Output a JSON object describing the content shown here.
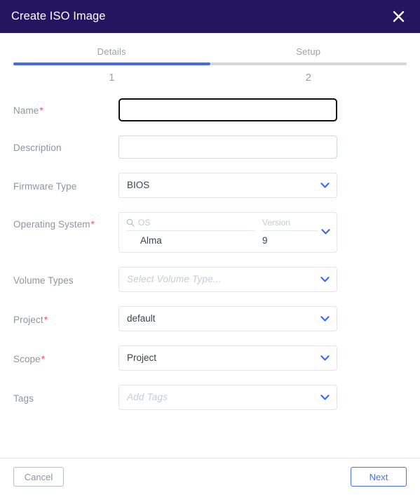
{
  "header": {
    "title": "Create ISO Image",
    "close_icon": "close-icon",
    "background_color": "#231560"
  },
  "stepper": {
    "active_color": "#3f6bf5",
    "inactive_color": "#d6d6d6",
    "steps": [
      {
        "label": "Details",
        "number": "1",
        "active": true
      },
      {
        "label": "Setup",
        "number": "2",
        "active": false
      }
    ]
  },
  "form": {
    "name": {
      "label": "Name",
      "required": "*",
      "value": "",
      "placeholder": "",
      "focused": true
    },
    "description": {
      "label": "Description",
      "value": "",
      "placeholder": ""
    },
    "firmware_type": {
      "label": "Firmware Type",
      "value": "BIOS",
      "chevron_icon": "chevron-down-icon"
    },
    "operating_system": {
      "label": "Operating System",
      "required": "*",
      "search_icon": "search-icon",
      "os_placeholder": "OS",
      "os_search_value": "",
      "version_placeholder": "Version",
      "version_search_value": "",
      "columns": [
        "OS",
        "Version"
      ],
      "rows": [
        {
          "os": "Alma",
          "version": "9"
        }
      ],
      "chevron_icon": "chevron-down-icon"
    },
    "volume_types": {
      "label": "Volume Types",
      "value": "",
      "placeholder": "Select Volume Type...",
      "chevron_icon": "chevron-down-icon"
    },
    "project": {
      "label": "Project",
      "required": "*",
      "value": "default",
      "chevron_icon": "chevron-down-icon"
    },
    "scope": {
      "label": "Scope",
      "required": "*",
      "value": "Project",
      "chevron_icon": "chevron-down-icon"
    },
    "tags": {
      "label": "Tags",
      "value": "",
      "placeholder": "Add Tags",
      "chevron_icon": "chevron-down-icon"
    }
  },
  "footer": {
    "cancel_label": "Cancel",
    "next_label": "Next",
    "next_color": "#4372f3"
  }
}
